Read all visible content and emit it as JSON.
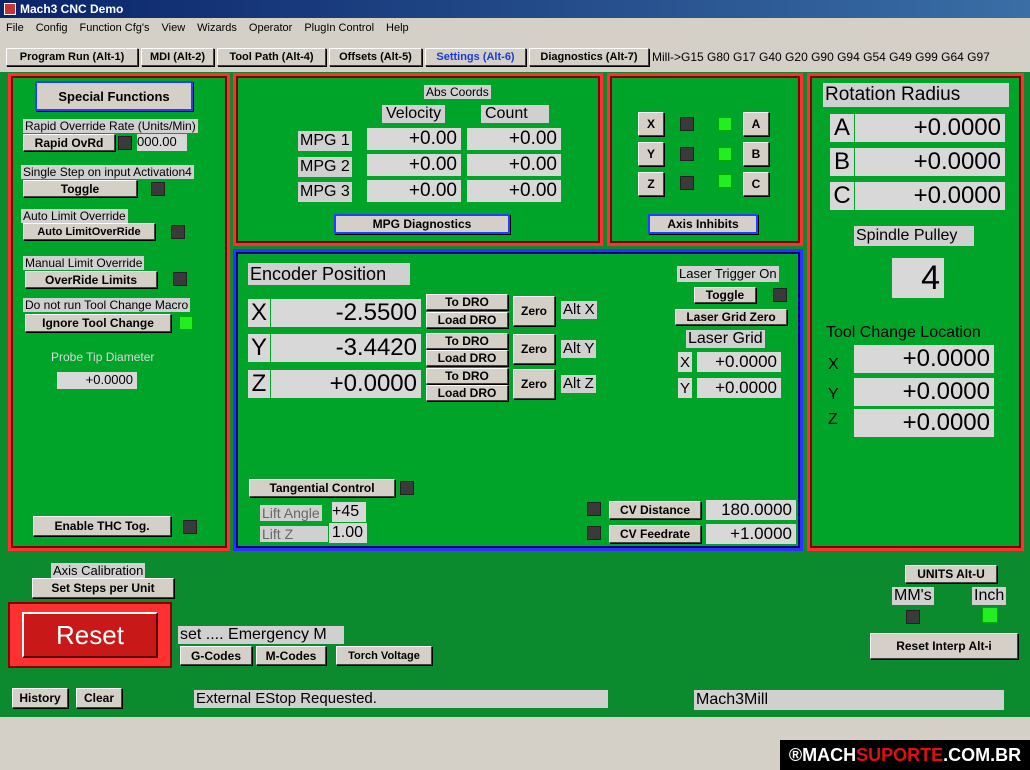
{
  "window": {
    "title": "Mach3 CNC  Demo"
  },
  "menu": [
    "File",
    "Config",
    "Function Cfg's",
    "View",
    "Wizards",
    "Operator",
    "PlugIn Control",
    "Help"
  ],
  "tabs": [
    "Program Run (Alt-1)",
    "MDI (Alt-2)",
    "Tool Path (Alt-4)",
    "Offsets (Alt-5)",
    "Settings (Alt-6)",
    "Diagnostics (Alt-7)"
  ],
  "active_tab": "Settings (Alt-6)",
  "modal_codes": "Mill->G15  G80 G17 G40 G20 G90 G94 G54 G49 G99 G64 G97",
  "special": {
    "title": "Special Functions",
    "rapid_label": "Rapid Override Rate (Units/Min)",
    "rapid_btn": "Rapid OvRd",
    "rapid_value": "000.00",
    "single_step_label": "Single Step on input Activation4",
    "toggle_btn": "Toggle",
    "auto_limit_label": "Auto Limit Override",
    "auto_limit_btn": "Auto LimitOverRide",
    "manual_limit_label": "Manual Limit Override",
    "override_btn": "OverRide Limits",
    "no_tc_label": "Do not run Tool Change Macro",
    "ignore_tc_btn": "Ignore Tool Change",
    "probe_label": "Probe Tip Diameter",
    "probe_value": "+0.0000",
    "thc_btn": "Enable THC Tog."
  },
  "mpg": {
    "abs_label": "Abs Coords",
    "velocity": "Velocity",
    "count": "Count",
    "rows": [
      {
        "name": "MPG 1",
        "vel": "+0.00",
        "cnt": "+0.00"
      },
      {
        "name": "MPG 2",
        "vel": "+0.00",
        "cnt": "+0.00"
      },
      {
        "name": "MPG 3",
        "vel": "+0.00",
        "cnt": "+0.00"
      }
    ],
    "diag_btn": "MPG Diagnostics"
  },
  "inhibits": {
    "left": [
      "X",
      "Y",
      "Z"
    ],
    "right": [
      "A",
      "B",
      "C"
    ],
    "btn": "Axis Inhibits"
  },
  "rotation": {
    "title": "Rotation Radius",
    "rows": [
      {
        "axis": "A",
        "value": "+0.0000"
      },
      {
        "axis": "B",
        "value": "+0.0000"
      },
      {
        "axis": "C",
        "value": "+0.0000"
      }
    ],
    "pulley_label": "Spindle Pulley",
    "pulley_value": "4",
    "tc_label": "Tool Change Location",
    "tc_rows": [
      {
        "axis": "X",
        "value": "+0.0000"
      },
      {
        "axis": "Y",
        "value": "+0.0000"
      },
      {
        "axis": "Z",
        "value": "+0.0000"
      }
    ]
  },
  "encoder": {
    "title": "Encoder Position",
    "rows": [
      {
        "axis": "X",
        "value": "-2.5500",
        "alt": "Alt X"
      },
      {
        "axis": "Y",
        "value": "-3.4420",
        "alt": "Alt Y"
      },
      {
        "axis": "Z",
        "value": "+0.0000",
        "alt": "Alt Z"
      }
    ],
    "to_dro": "To DRO",
    "load_dro": "Load DRO",
    "zero": "Zero",
    "laser_label": "Laser Trigger On",
    "laser_toggle": "Toggle",
    "laser_zero": "Laser Grid Zero",
    "laser_grid": "Laser Grid",
    "laser_rows": [
      {
        "axis": "X",
        "value": "+0.0000"
      },
      {
        "axis": "Y",
        "value": "+0.0000"
      }
    ],
    "tangential_btn": "Tangential Control",
    "lift_angle_label": "Lift Angle",
    "lift_angle": "+45",
    "lift_z_label": "Lift Z",
    "lift_z": "1.00",
    "cv_distance_btn": "CV Distance",
    "cv_distance": "180.0000",
    "cv_feedrate_btn": "CV Feedrate",
    "cv_feedrate": "+1.0000"
  },
  "bottom": {
    "axis_cal": "Axis Calibration",
    "set_steps": "Set Steps per Unit",
    "reset": "Reset",
    "message": "set .... Emergency M",
    "gcodes": "G-Codes",
    "mcodes": "M-Codes",
    "torch": "Torch Voltage",
    "units_btn": "UNITS Alt-U",
    "mm": "MM's",
    "inch": "Inch",
    "reset_interp": "Reset Interp Alt-i"
  },
  "status": {
    "history": "History",
    "clear": "Clear",
    "message": "External EStop Requested.",
    "profile": "Mach3Mill"
  },
  "brand": {
    "a": "®MACH",
    "b": "SUPORTE",
    ".c": "",
    "c": ".COM.BR"
  },
  "colors": {
    "panel_bg": "#00a428",
    "frame_red": "#ff3030",
    "frame_blue": "#3030ff",
    "led_on": "#22ee22"
  }
}
